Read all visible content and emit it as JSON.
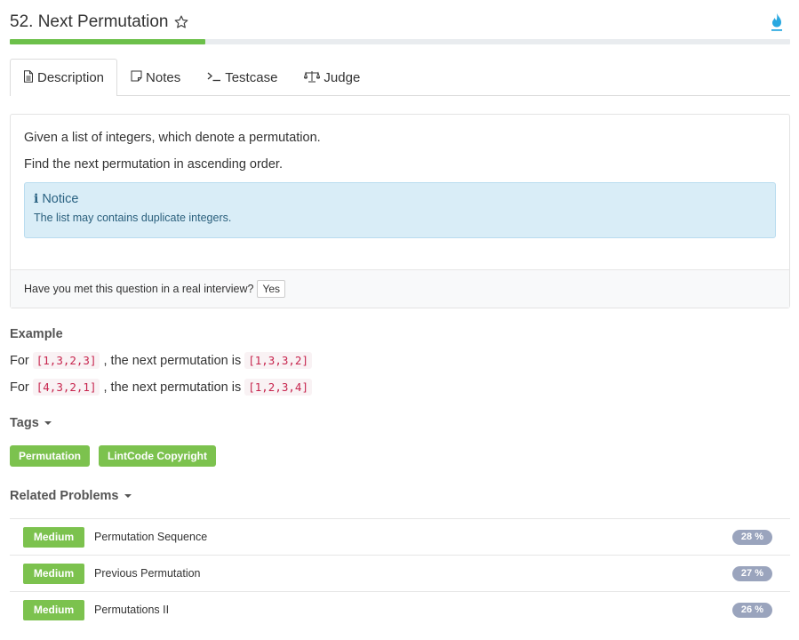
{
  "problem": {
    "title": "52. Next Permutation",
    "progress_percent": 25
  },
  "tabs": [
    {
      "label": "Description",
      "icon": "document-icon",
      "active": true
    },
    {
      "label": "Notes",
      "icon": "note-icon",
      "active": false
    },
    {
      "label": "Testcase",
      "icon": "terminal-icon",
      "active": false
    },
    {
      "label": "Judge",
      "icon": "scale-icon",
      "active": false
    }
  ],
  "description": {
    "line1": "Given a list of integers, which denote a permutation.",
    "line2": "Find the next permutation in ascending order.",
    "notice_title": "Notice",
    "notice_text": "The list may contains duplicate integers.",
    "interview_question": "Have you met this question in a real interview?",
    "yes_label": "Yes"
  },
  "example": {
    "heading": "Example",
    "rows": [
      {
        "prefix": "For",
        "input": "[1,3,2,3]",
        "middle": ", the next permutation is",
        "output": "[1,3,3,2]"
      },
      {
        "prefix": "For",
        "input": "[4,3,2,1]",
        "middle": ", the next permutation is",
        "output": "[1,2,3,4]"
      }
    ]
  },
  "tags": {
    "heading": "Tags",
    "items": [
      "Permutation",
      "LintCode Copyright"
    ]
  },
  "related": {
    "heading": "Related Problems",
    "items": [
      {
        "difficulty": "Medium",
        "name": "Permutation Sequence",
        "rate": "28 %"
      },
      {
        "difficulty": "Medium",
        "name": "Previous Permutation",
        "rate": "27 %"
      },
      {
        "difficulty": "Medium",
        "name": "Permutations II",
        "rate": "26 %"
      }
    ]
  },
  "colors": {
    "accent_green": "#7cc24e",
    "notice_bg": "#d9edf7",
    "code_red": "#c7254e",
    "rate_badge": "#9aa4bd",
    "flame_blue": "#29a8e0"
  }
}
